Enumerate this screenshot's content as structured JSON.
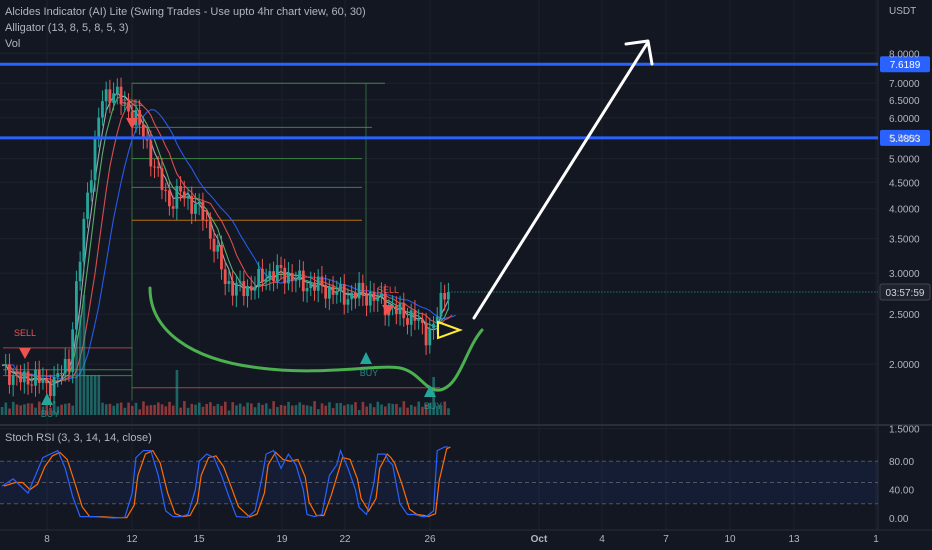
{
  "currency": "USDT",
  "indicators": {
    "main": "Alcides Indicator (AI) Lite (Swing Trades - Use upto 4hr chart view, 60, 30)",
    "alligator": "Alligator (13, 8, 5, 8, 5, 3)",
    "vol": "Vol",
    "stoch": "Stoch RSI (3, 3, 14, 14, close)"
  },
  "colors": {
    "background": "#131722",
    "up": "#26a69a",
    "down": "#ef5350",
    "level": "#2962ff",
    "stoch_k": "#2962ff",
    "stoch_d": "#ff6d00",
    "annotation_green": "#4caf50",
    "annotation_white": "#ffffff"
  },
  "chart_data": {
    "type": "candlestick",
    "x_ticks": [
      "8",
      "12",
      "15",
      "19",
      "22",
      "26",
      "Oct",
      "4",
      "7",
      "10",
      "13",
      "1"
    ],
    "price_axis": {
      "ticks": [
        "8.0000",
        "7.0000",
        "6.5000",
        "6.0000",
        "5.5000",
        "5.0000",
        "4.5000",
        "4.0000",
        "3.5000",
        "3.0000",
        "2.5000",
        "2.0000",
        "1.5000"
      ],
      "range": [
        1.3,
        8.3
      ]
    },
    "levels": [
      {
        "value": 7.6189,
        "label": "7.6189"
      },
      {
        "value": 5.4853,
        "label": "5.4853"
      }
    ],
    "current_price_label": "03:57:59",
    "signals": [
      {
        "label": "SELL",
        "type": "sell"
      },
      {
        "label": "SELL",
        "type": "sell"
      },
      {
        "label": "SELL",
        "type": "sell"
      },
      {
        "label": "BUY",
        "type": "buy"
      },
      {
        "label": "BUY",
        "type": "buy"
      },
      {
        "label": "BUY",
        "type": "buy"
      }
    ],
    "price_path": [
      [
        0,
        1.95
      ],
      [
        3,
        1.9
      ],
      [
        6,
        1.85
      ],
      [
        9,
        1.9
      ],
      [
        12,
        1.8
      ],
      [
        15,
        1.9
      ],
      [
        18,
        2.0
      ],
      [
        21,
        3.2
      ],
      [
        24,
        4.8
      ],
      [
        27,
        6.5
      ],
      [
        30,
        6.8
      ],
      [
        33,
        6.3
      ],
      [
        36,
        6.0
      ],
      [
        39,
        5.3
      ],
      [
        42,
        4.6
      ],
      [
        45,
        4.1
      ],
      [
        48,
        4.3
      ],
      [
        51,
        4.1
      ],
      [
        54,
        3.9
      ],
      [
        57,
        3.4
      ],
      [
        60,
        2.9
      ],
      [
        63,
        2.8
      ],
      [
        66,
        2.8
      ],
      [
        69,
        2.9
      ],
      [
        72,
        3.0
      ],
      [
        75,
        3.0
      ],
      [
        78,
        2.95
      ],
      [
        81,
        2.85
      ],
      [
        84,
        2.85
      ],
      [
        87,
        2.8
      ],
      [
        90,
        2.75
      ],
      [
        93,
        2.7
      ],
      [
        96,
        2.75
      ],
      [
        99,
        2.7
      ],
      [
        102,
        2.65
      ],
      [
        105,
        2.55
      ],
      [
        108,
        2.5
      ],
      [
        111,
        2.45
      ],
      [
        114,
        2.3
      ],
      [
        116,
        2.35
      ],
      [
        118,
        2.65
      ],
      [
        120,
        2.85
      ]
    ],
    "stoch_rsi": {
      "ticks": [
        "80.00",
        "40.00",
        "0.00"
      ],
      "k": [
        [
          0,
          45
        ],
        [
          3,
          55
        ],
        [
          5,
          45
        ],
        [
          7,
          35
        ],
        [
          9,
          60
        ],
        [
          11,
          85
        ],
        [
          13,
          90
        ],
        [
          15,
          95
        ],
        [
          17,
          70
        ],
        [
          19,
          30
        ],
        [
          21,
          2
        ],
        [
          23,
          2
        ],
        [
          25,
          2
        ],
        [
          27,
          1
        ],
        [
          30,
          0
        ],
        [
          33,
          1
        ],
        [
          35,
          35
        ],
        [
          36,
          85
        ],
        [
          38,
          95
        ],
        [
          40,
          95
        ],
        [
          42,
          60
        ],
        [
          44,
          10
        ],
        [
          46,
          2
        ],
        [
          48,
          2
        ],
        [
          50,
          5
        ],
        [
          52,
          40
        ],
        [
          53,
          80
        ],
        [
          55,
          90
        ],
        [
          57,
          85
        ],
        [
          59,
          60
        ],
        [
          61,
          30
        ],
        [
          63,
          2
        ],
        [
          66,
          1
        ],
        [
          68,
          10
        ],
        [
          70,
          60
        ],
        [
          71,
          90
        ],
        [
          73,
          95
        ],
        [
          75,
          70
        ],
        [
          77,
          90
        ],
        [
          79,
          75
        ],
        [
          81,
          40
        ],
        [
          82,
          5
        ],
        [
          84,
          2
        ],
        [
          86,
          5
        ],
        [
          88,
          60
        ],
        [
          90,
          75
        ],
        [
          91,
          95
        ],
        [
          93,
          70
        ],
        [
          95,
          40
        ],
        [
          96,
          15
        ],
        [
          98,
          5
        ],
        [
          100,
          50
        ],
        [
          101,
          90
        ],
        [
          103,
          90
        ],
        [
          104,
          80
        ],
        [
          105,
          75
        ],
        [
          107,
          20
        ],
        [
          109,
          5
        ],
        [
          111,
          5
        ],
        [
          113,
          2
        ],
        [
          114,
          2
        ],
        [
          116,
          10
        ],
        [
          117,
          95
        ],
        [
          119,
          100
        ],
        [
          120,
          100
        ]
      ]
    }
  }
}
